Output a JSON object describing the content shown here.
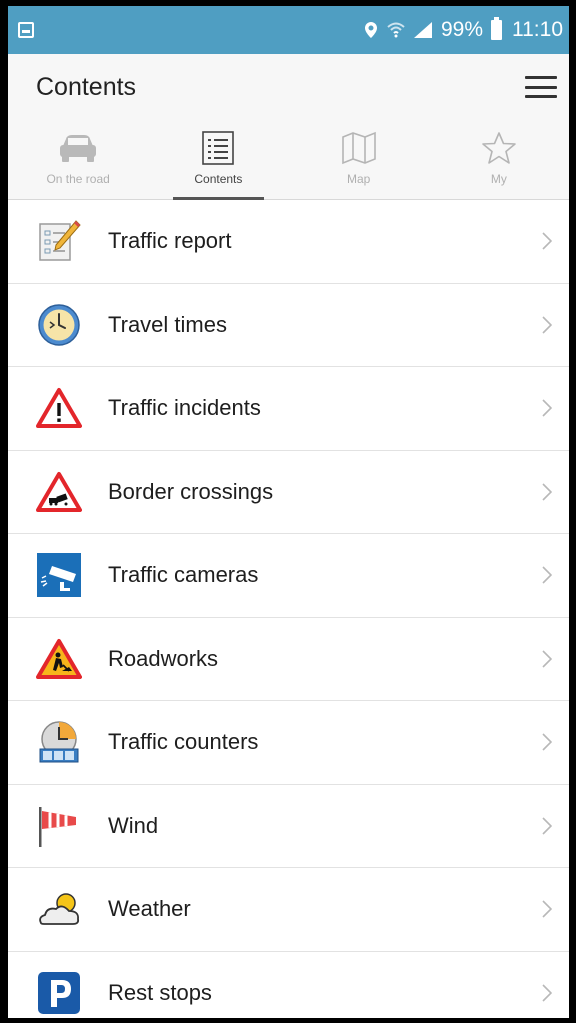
{
  "status_bar": {
    "battery": "99%",
    "time": "11:10",
    "icons": [
      "image-icon",
      "location-icon",
      "wifi-icon",
      "signal-icon",
      "battery-icon"
    ]
  },
  "header": {
    "title": "Contents",
    "menu_icon": "hamburger-menu-icon"
  },
  "tabs": [
    {
      "label": "On the road",
      "icon": "car-icon",
      "active": false
    },
    {
      "label": "Contents",
      "icon": "list-icon",
      "active": true
    },
    {
      "label": "Map",
      "icon": "map-icon",
      "active": false
    },
    {
      "label": "My",
      "icon": "star-icon",
      "active": false
    }
  ],
  "items": [
    {
      "label": "Traffic report",
      "icon": "report-pencil-icon"
    },
    {
      "label": "Travel times",
      "icon": "clock-icon"
    },
    {
      "label": "Traffic incidents",
      "icon": "warning-icon"
    },
    {
      "label": "Border crossings",
      "icon": "queue-warning-icon"
    },
    {
      "label": "Traffic cameras",
      "icon": "camera-icon"
    },
    {
      "label": "Roadworks",
      "icon": "roadworks-icon"
    },
    {
      "label": "Traffic counters",
      "icon": "counter-icon"
    },
    {
      "label": "Wind",
      "icon": "windsock-icon"
    },
    {
      "label": "Weather",
      "icon": "weather-icon"
    },
    {
      "label": "Rest stops",
      "icon": "parking-icon"
    }
  ],
  "colors": {
    "status_bar": "#4f9ec2",
    "header_bg": "#f7f7f7",
    "warning_red": "#e3262b",
    "camera_blue": "#1b6fb8",
    "parking_blue": "#1a5aa8"
  }
}
